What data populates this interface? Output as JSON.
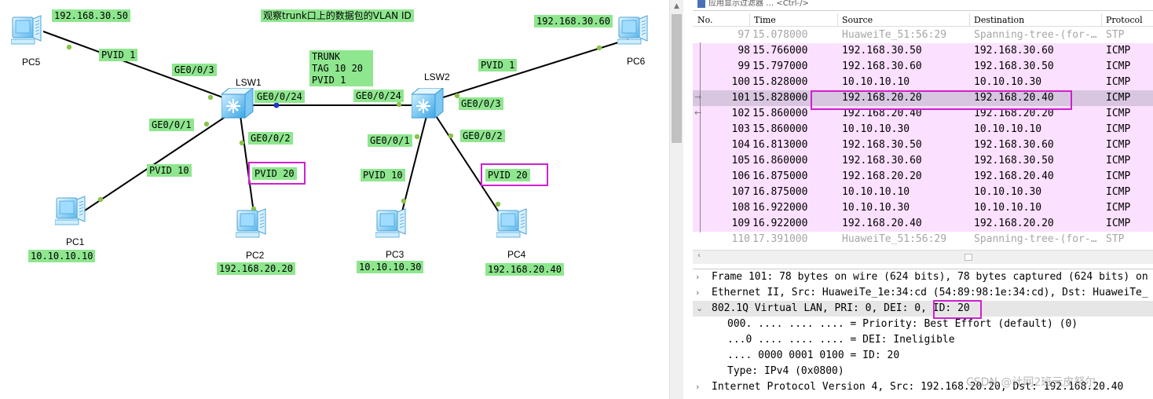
{
  "topology": {
    "title": "观察trunk口上的数据包的VLAN ID",
    "devices": {
      "pc5": {
        "name": "PC5",
        "ip": "192.168.30.50"
      },
      "pc6": {
        "name": "PC6",
        "ip": "192.168.30.60"
      },
      "pc1": {
        "name": "PC1",
        "ip": "10.10.10.10"
      },
      "pc2": {
        "name": "PC2",
        "ip": "192.168.20.20"
      },
      "pc3": {
        "name": "PC3",
        "ip": "10.10.10.30"
      },
      "pc4": {
        "name": "PC4",
        "ip": "192.168.20.40"
      },
      "lsw1": {
        "name": "LSW1"
      },
      "lsw2": {
        "name": "LSW2"
      }
    },
    "labels": {
      "pvid_pc5": "PVID 1",
      "pvid_pc6": "PVID 1",
      "pvid_pc1": "PVID 10",
      "pvid_pc2": "PVID 20",
      "pvid_pc3": "PVID 10",
      "pvid_pc4": "PVID 20",
      "lsw1_ge3": "GE0/0/3",
      "lsw1_ge1": "GE0/0/1",
      "lsw1_ge2": "GE0/0/2",
      "lsw1_ge24": "GE0/0/24",
      "lsw2_ge24": "GE0/0/24",
      "lsw2_ge3": "GE0/0/3",
      "lsw2_ge1": "GE0/0/1",
      "lsw2_ge2": "GE0/0/2"
    },
    "trunk_info": [
      "TRUNK",
      "TAG 10 20",
      "PVID 1"
    ]
  },
  "wireshark": {
    "filter_placeholder": "应用显示过滤器 … <Ctrl-/>",
    "columns": [
      "No.",
      "Time",
      "Source",
      "Destination",
      "Protocol"
    ],
    "packets": [
      {
        "no": "97",
        "time": "15.078000",
        "src": "HuaweiTe_51:56:29",
        "dst": "Spanning-tree-(for-…",
        "proto": "STP",
        "kind": "stp"
      },
      {
        "no": "98",
        "time": "15.766000",
        "src": "192.168.30.50",
        "dst": "192.168.30.60",
        "proto": "ICMP",
        "kind": "icmp"
      },
      {
        "no": "99",
        "time": "15.797000",
        "src": "192.168.30.60",
        "dst": "192.168.30.50",
        "proto": "ICMP",
        "kind": "icmp"
      },
      {
        "no": "100",
        "time": "15.828000",
        "src": "10.10.10.10",
        "dst": "10.10.10.30",
        "proto": "ICMP",
        "kind": "icmp"
      },
      {
        "no": "101",
        "time": "15.828000",
        "src": "192.168.20.20",
        "dst": "192.168.20.40",
        "proto": "ICMP",
        "kind": "sel"
      },
      {
        "no": "102",
        "time": "15.860000",
        "src": "192.168.20.40",
        "dst": "192.168.20.20",
        "proto": "ICMP",
        "kind": "icmp"
      },
      {
        "no": "103",
        "time": "15.860000",
        "src": "10.10.10.30",
        "dst": "10.10.10.10",
        "proto": "ICMP",
        "kind": "icmp"
      },
      {
        "no": "104",
        "time": "16.813000",
        "src": "192.168.30.50",
        "dst": "192.168.30.60",
        "proto": "ICMP",
        "kind": "icmp"
      },
      {
        "no": "105",
        "time": "16.860000",
        "src": "192.168.30.60",
        "dst": "192.168.30.50",
        "proto": "ICMP",
        "kind": "icmp"
      },
      {
        "no": "106",
        "time": "16.875000",
        "src": "192.168.20.20",
        "dst": "192.168.20.40",
        "proto": "ICMP",
        "kind": "icmp"
      },
      {
        "no": "107",
        "time": "16.875000",
        "src": "10.10.10.10",
        "dst": "10.10.10.30",
        "proto": "ICMP",
        "kind": "icmp"
      },
      {
        "no": "108",
        "time": "16.922000",
        "src": "10.10.10.30",
        "dst": "10.10.10.10",
        "proto": "ICMP",
        "kind": "icmp"
      },
      {
        "no": "109",
        "time": "16.922000",
        "src": "192.168.20.40",
        "dst": "192.168.20.20",
        "proto": "ICMP",
        "kind": "icmp"
      },
      {
        "no": "110",
        "time": "17.391000",
        "src": "HuaweiTe_51:56:29",
        "dst": "Spanning-tree-(for-…",
        "proto": "STP",
        "kind": "stp"
      }
    ],
    "details": [
      {
        "text": "Frame 101: 78 bytes on wire (624 bits), 78 bytes captured (624 bits) on",
        "state": "collapsed",
        "child": false
      },
      {
        "text": "Ethernet II, Src: HuaweiTe_1e:34:cd (54:89:98:1e:34:cd), Dst: HuaweiTe_",
        "state": "collapsed",
        "child": false
      },
      {
        "text": "802.1Q Virtual LAN, PRI: 0, DEI: 0, ID: 20",
        "state": "expanded",
        "child": false
      },
      {
        "text": "000. .... .... .... = Priority: Best Effort (default) (0)",
        "state": "none",
        "child": true
      },
      {
        "text": "...0 .... .... .... = DEI: Ineligible",
        "state": "none",
        "child": true
      },
      {
        "text": ".... 0000 0001 0100 = ID: 20",
        "state": "none",
        "child": true
      },
      {
        "text": "Type: IPv4 (0x0800)",
        "state": "none",
        "child": true
      },
      {
        "text": "Internet Protocol Version 4, Src: 192.168.20.20, Dst: 192.168.20.40",
        "state": "collapsed",
        "child": false
      }
    ],
    "watermark": "CSDN @计网2班元皮努尔"
  },
  "colors": {
    "label_bg": "#8ee68e",
    "highlight": "#d020d0",
    "icmp_row": "#fce0ff",
    "selected_row": "#d8c6e0",
    "link": "#000000",
    "port_dot": "#8bc34a"
  }
}
